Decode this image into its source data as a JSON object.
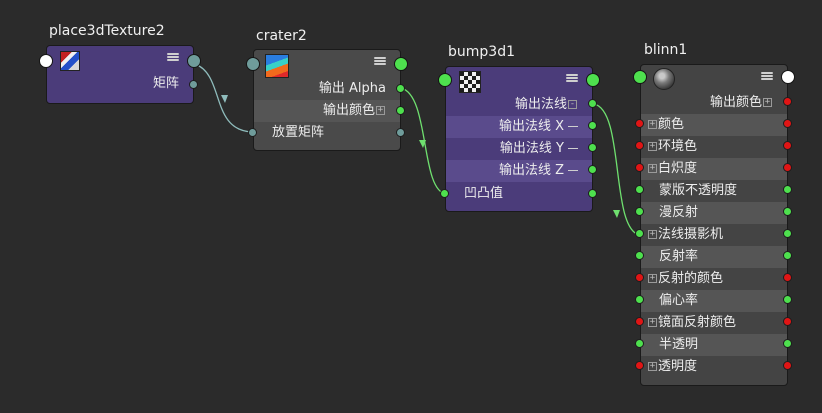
{
  "nodes": {
    "place3d": {
      "title": "place3dTexture2",
      "outputs": [
        "矩阵"
      ]
    },
    "crater": {
      "title": "crater2",
      "outputs": [
        "输出 Alpha",
        "输出颜色"
      ],
      "inputs": [
        "放置矩阵"
      ]
    },
    "bump": {
      "title": "bump3d1",
      "outputs": [
        "输出法线",
        "输出法线 X",
        "输出法线 Y",
        "输出法线 Z"
      ],
      "inputs": [
        "凹凸值"
      ]
    },
    "blinn": {
      "title": "blinn1",
      "output": "输出颜色",
      "attributes": [
        "颜色",
        "环境色",
        "白炽度",
        "蒙版不透明度",
        "漫反射",
        "法线摄影机",
        "反射率",
        "反射的颜色",
        "偏心率",
        "镜面反射颜色",
        "半透明",
        "透明度"
      ]
    }
  },
  "icons": {
    "menu": "list-menu-icon",
    "expand": "plus-box-icon",
    "collapse": "minus-box-icon"
  },
  "colors": {
    "background": "#2b2b2b",
    "node_purple": "#4b3c7a",
    "node_gray": "#4a4a4a",
    "plug_green": "#4ee04e",
    "plug_red": "#e01515",
    "plug_teal": "#6f9c9b",
    "wire_teal": "#8fbcbc",
    "wire_green": "#6fe06f"
  }
}
